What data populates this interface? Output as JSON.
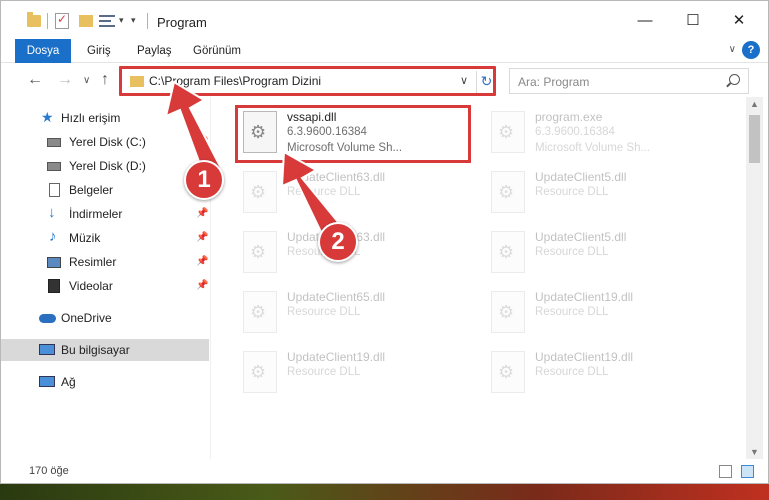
{
  "window": {
    "title": "Program",
    "controls": {
      "minimize": "—",
      "maximize": "☐",
      "close": "✕"
    }
  },
  "ribbon": {
    "tabs": [
      "Dosya",
      "Giriş",
      "Paylaş",
      "Görünüm"
    ],
    "help": "?"
  },
  "navbar": {
    "address": "C:\\Program Files\\Program Dizini",
    "search_placeholder": "Ara: Program"
  },
  "sidebar": {
    "items": [
      {
        "label": "Hızlı erişim",
        "icon": "star-icon"
      },
      {
        "label": "Yerel Disk (C:)",
        "icon": "drive-icon",
        "pinned": true
      },
      {
        "label": "Yerel Disk (D:)",
        "icon": "drive-icon"
      },
      {
        "label": "Belgeler",
        "icon": "documents-icon",
        "pinned": true
      },
      {
        "label": "İndirmeler",
        "icon": "download-icon",
        "pinned": true
      },
      {
        "label": "Müzik",
        "icon": "music-icon",
        "pinned": true
      },
      {
        "label": "Resimler",
        "icon": "pictures-icon",
        "pinned": true
      },
      {
        "label": "Videolar",
        "icon": "videos-icon",
        "pinned": true
      },
      {
        "label": "OneDrive",
        "icon": "cloud-icon"
      },
      {
        "label": "Bu bilgisayar",
        "icon": "computer-icon",
        "selected": true
      },
      {
        "label": "Ağ",
        "icon": "network-icon"
      }
    ]
  },
  "files": [
    {
      "name": "vssapi.dll",
      "version": "6.3.9600.16384",
      "desc": "Microsoft Volume Sh...",
      "highlighted": true
    },
    {
      "name": "program.exe",
      "version": "6.3.9600.16384",
      "desc": "Microsoft Volume Sh..."
    },
    {
      "name": "UpdateClient63.dll",
      "desc": "Resource DLL"
    },
    {
      "name": "UpdateClient5.dll",
      "desc": "Resource DLL"
    },
    {
      "name": "UpdateClient63.dll",
      "desc": "Resource DLL"
    },
    {
      "name": "UpdateClient5.dll",
      "desc": "Resource DLL"
    },
    {
      "name": "UpdateClient65.dll",
      "desc": "Resource DLL"
    },
    {
      "name": "UpdateClient19.dll",
      "desc": "Resource DLL"
    },
    {
      "name": "UpdateClient19.dll",
      "desc": "Resource DLL"
    },
    {
      "name": "UpdateClient19.dll",
      "desc": "Resource DLL"
    }
  ],
  "status": {
    "count": "170 öğe"
  },
  "markers": [
    "1",
    "2"
  ],
  "colors": {
    "accent": "#1a6fc8",
    "highlight": "#d83a3a"
  }
}
